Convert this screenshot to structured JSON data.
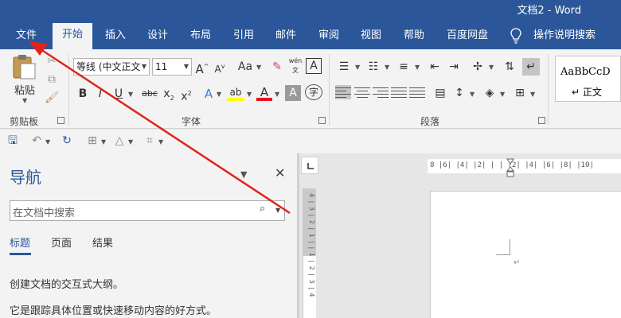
{
  "window": {
    "title": "文档2 - Word"
  },
  "tabs": [
    {
      "label": "文件"
    },
    {
      "label": "开始"
    },
    {
      "label": "插入"
    },
    {
      "label": "设计"
    },
    {
      "label": "布局"
    },
    {
      "label": "引用"
    },
    {
      "label": "邮件"
    },
    {
      "label": "审阅"
    },
    {
      "label": "视图"
    },
    {
      "label": "帮助"
    },
    {
      "label": "百度网盘"
    },
    {
      "label": "操作说明搜索"
    }
  ],
  "active_tab": "开始",
  "ribbon": {
    "clipboard": {
      "paste_label": "粘贴",
      "group_label": "剪贴板"
    },
    "font": {
      "font_name": "等线 (中文正文",
      "font_size": "11",
      "grow_label": "A",
      "shrink_label": "A",
      "case_label": "Aa",
      "phonetic_label": "wén",
      "bold": "B",
      "italic": "I",
      "underline": "U",
      "strike": "abc",
      "subscript": "x",
      "superscript": "x",
      "subscript_small": "2",
      "superscript_small": "2",
      "group_label": "字体"
    },
    "paragraph": {
      "group_label": "段落"
    },
    "styles": {
      "sample": "AaBbCcD",
      "name": "↵ 正文"
    }
  },
  "navigation": {
    "title": "导航",
    "search_placeholder": "在文档中搜索",
    "tabs": [
      {
        "label": "标题"
      },
      {
        "label": "页面"
      },
      {
        "label": "结果"
      }
    ],
    "active_tab": "标题",
    "lines": [
      "创建文档的交互式大纲。",
      "它是跟踪具体位置或快速移动内容的好方式。"
    ]
  },
  "ruler": {
    "horizontal_ticks": "8 |6| |4| |2| | | |2| |4| |6| |8| |10|",
    "vertical_ticks": "4 | 3 | 2 | 1 | | 1 | 2 | 3 | 4"
  },
  "document": {
    "paragraph_mark": "↵"
  },
  "colors": {
    "accent": "#2b579a",
    "annotation": "#e0241b",
    "highlight": "#ffff00",
    "font_color": "#e81123"
  }
}
